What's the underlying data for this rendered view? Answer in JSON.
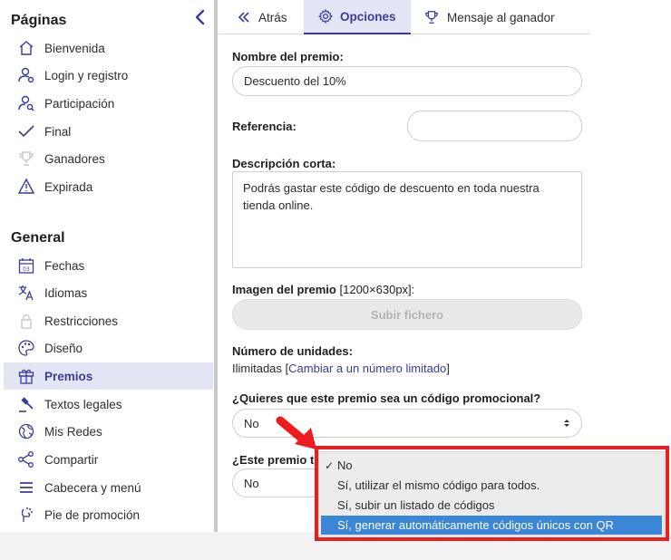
{
  "sidebar": {
    "section_paginas": "Páginas",
    "paginas_items": [
      {
        "label": "Bienvenida",
        "icon": "home-icon"
      },
      {
        "label": "Login y registro",
        "icon": "user-login-icon"
      },
      {
        "label": "Participación",
        "icon": "user-search-icon"
      },
      {
        "label": "Final",
        "icon": "check-icon"
      },
      {
        "label": "Ganadores",
        "icon": "trophy-icon"
      },
      {
        "label": "Expirada",
        "icon": "warning-icon"
      }
    ],
    "section_general": "General",
    "general_items": [
      {
        "label": "Fechas",
        "icon": "calendar-icon"
      },
      {
        "label": "Idiomas",
        "icon": "translate-icon"
      },
      {
        "label": "Restricciones",
        "icon": "lock-icon"
      },
      {
        "label": "Diseño",
        "icon": "palette-icon"
      },
      {
        "label": "Premios",
        "icon": "gift-icon",
        "active": true
      },
      {
        "label": "Textos legales",
        "icon": "gavel-icon"
      },
      {
        "label": "Mis Redes",
        "icon": "globe-icon"
      },
      {
        "label": "Compartir",
        "icon": "share-icon"
      },
      {
        "label": "Cabecera y menú",
        "icon": "menu-icon"
      },
      {
        "label": "Pie de promoción",
        "icon": "footer-icon"
      }
    ]
  },
  "tabs": {
    "back": "Atrás",
    "options": "Opciones",
    "winner_message": "Mensaje al ganador"
  },
  "form": {
    "prize_name_label": "Nombre del premio:",
    "prize_name_value": "Descuento del 10%",
    "reference_label": "Referencia:",
    "reference_value": "",
    "short_desc_label": "Descripción corta:",
    "short_desc_value": "Podrás gastar este código de descuento en toda nuestra tienda online.",
    "image_label": "Imagen del premio",
    "image_size": "[1200×630px]:",
    "upload_button": "Subir fichero",
    "units_label": "Número de unidades:",
    "units_value": "Ilimitadas",
    "units_link": "Cambiar a un número limitado",
    "promo_question": "¿Quieres que este premio sea un código promocional?",
    "promo_select_value": "No",
    "second_question": "¿Este premio ti",
    "second_select_value": "No"
  },
  "dropdown": {
    "options": [
      {
        "label": "No",
        "checked": true
      },
      {
        "label": "Sí, utilizar el mismo código para todos."
      },
      {
        "label": "Sí, subir un listado de códigos"
      },
      {
        "label": "Sí, generar automáticamente códigos únicos con QR",
        "highlighted": true
      }
    ]
  },
  "colors": {
    "accent": "#3b3c98",
    "active_bg": "#e4e5f4",
    "highlight": "#ee1c1c",
    "option_highlight": "#3c86d8"
  }
}
